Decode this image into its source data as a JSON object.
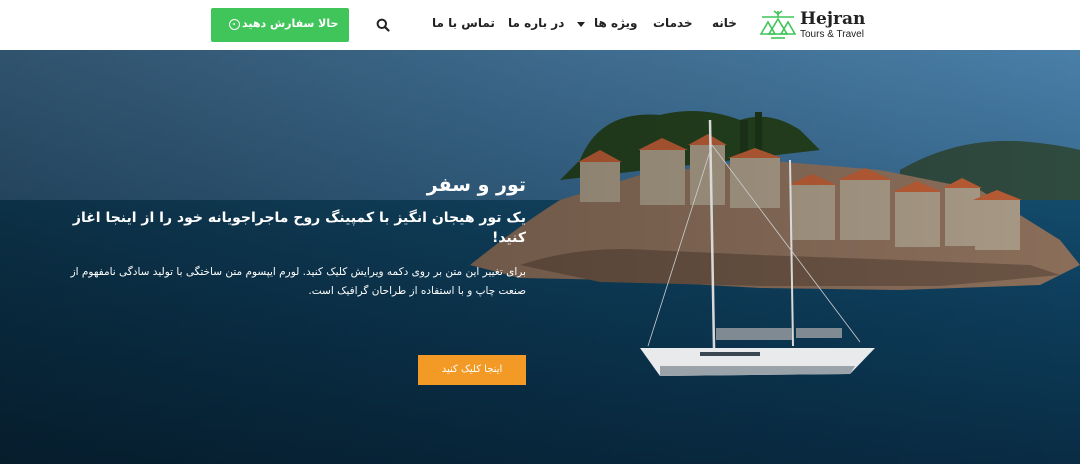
{
  "brand": {
    "title": "Hejran",
    "subtitle": "Tours & Travel",
    "color": "#3fc55a"
  },
  "nav": {
    "items": [
      {
        "label": "خانه"
      },
      {
        "label": "خدمات"
      },
      {
        "label": "ویژه ها"
      },
      {
        "label": "در باره ما"
      },
      {
        "label": "تماس با ما"
      }
    ],
    "search_icon": "search-icon",
    "cta_label": "حالا سفارش دهید",
    "cta_icon": "arrow-circle-left-icon"
  },
  "hero": {
    "title": "تور و سفر",
    "subtitle": "یک تور هیجان انگیز با کمپینگ روح ماجراجویانه خود را از اینجا اغاز کنید!",
    "body": "برای تغییر این متن بر روی دکمه ویرایش کلیک کنید. لورم ایپسوم متن ساختگی با تولید سادگی نامفهوم از صنعت چاپ و با استفاده از طراحان گرافیک است.",
    "button_label": "اینجا کلیک کنید",
    "button_color": "#f29a25"
  }
}
